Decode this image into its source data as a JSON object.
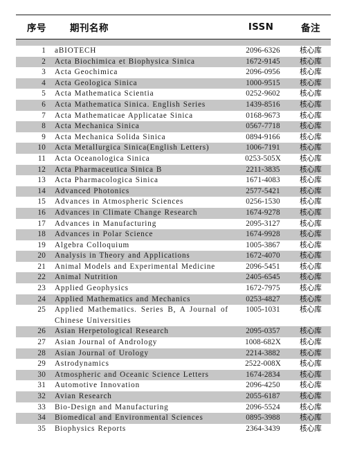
{
  "document": {
    "table": {
      "columns": [
        {
          "key": "index",
          "label": "序号"
        },
        {
          "key": "name",
          "label": "期刊名称"
        },
        {
          "key": "issn",
          "label": "ISSN"
        },
        {
          "key": "note",
          "label": "备注"
        }
      ],
      "rows": [
        {
          "index": "1",
          "name": "aBIOTECH",
          "issn": "2096-6326",
          "note": "核心库"
        },
        {
          "index": "2",
          "name": "Acta Biochimica et Biophysica Sinica",
          "issn": "1672-9145",
          "note": "核心库"
        },
        {
          "index": "3",
          "name": "Acta Geochimica",
          "issn": "2096-0956",
          "note": "核心库"
        },
        {
          "index": "4",
          "name": "Acta Geologica Sinica",
          "issn": "1000-9515",
          "note": "核心库"
        },
        {
          "index": "5",
          "name": "Acta Mathematica Scientia",
          "issn": "0252-9602",
          "note": "核心库"
        },
        {
          "index": "6",
          "name": "Acta Mathematica Sinica. English Series",
          "issn": "1439-8516",
          "note": "核心库"
        },
        {
          "index": "7",
          "name": "Acta Mathematicae Applicatae Sinica",
          "issn": "0168-9673",
          "note": "核心库"
        },
        {
          "index": "8",
          "name": "Acta Mechanica Sinica",
          "issn": "0567-7718",
          "note": "核心库"
        },
        {
          "index": "9",
          "name": "Acta Mechanica Solida Sinica",
          "issn": "0894-9166",
          "note": "核心库"
        },
        {
          "index": "10",
          "name": "Acta Metallurgica Sinica(English Letters)",
          "issn": "1006-7191",
          "note": "核心库"
        },
        {
          "index": "11",
          "name": "Acta Oceanologica Sinica",
          "issn": "0253-505X",
          "note": "核心库"
        },
        {
          "index": "12",
          "name": "Acta Pharmaceutica Sinica B",
          "issn": "2211-3835",
          "note": "核心库"
        },
        {
          "index": "13",
          "name": "Acta Pharmacologica Sinica",
          "issn": "1671-4083",
          "note": "核心库"
        },
        {
          "index": "14",
          "name": "Advanced Photonics",
          "issn": "2577-5421",
          "note": "核心库"
        },
        {
          "index": "15",
          "name": "Advances in Atmospheric Sciences",
          "issn": "0256-1530",
          "note": "核心库"
        },
        {
          "index": "16",
          "name": "Advances in Climate Change Research",
          "issn": "1674-9278",
          "note": "核心库"
        },
        {
          "index": "17",
          "name": "Advances in Manufacturing",
          "issn": "2095-3127",
          "note": "核心库"
        },
        {
          "index": "18",
          "name": "Advances in Polar Science",
          "issn": "1674-9928",
          "note": "核心库"
        },
        {
          "index": "19",
          "name": "Algebra Colloquium",
          "issn": "1005-3867",
          "note": "核心库"
        },
        {
          "index": "20",
          "name": "Analysis in Theory and Applications",
          "issn": "1672-4070",
          "note": "核心库"
        },
        {
          "index": "21",
          "name": "Animal Models and Experimental Medicine",
          "issn": "2096-5451",
          "note": "核心库"
        },
        {
          "index": "22",
          "name": "Animal Nutrition",
          "issn": "2405-6545",
          "note": "核心库"
        },
        {
          "index": "23",
          "name": "Applied Geophysics",
          "issn": "1672-7975",
          "note": "核心库"
        },
        {
          "index": "24",
          "name": "Applied Mathematics and Mechanics",
          "issn": "0253-4827",
          "note": "核心库"
        },
        {
          "index": "25",
          "name": "Applied Mathematics. Series B, A Journal of Chinese Universities",
          "name_lines": [
            "Applied Mathematics. Series B, A Journal of",
            "Chinese Universities"
          ],
          "issn": "1005-1031",
          "note": "核心库"
        },
        {
          "index": "26",
          "name": "Asian Herpetological Research",
          "issn": "2095-0357",
          "note": "核心库"
        },
        {
          "index": "27",
          "name": "Asian Journal of Andrology",
          "issn": "1008-682X",
          "note": "核心库"
        },
        {
          "index": "28",
          "name": "Asian Journal of Urology",
          "issn": "2214-3882",
          "note": "核心库"
        },
        {
          "index": "29",
          "name": "Astrodynamics",
          "issn": "2522-008X",
          "note": "核心库"
        },
        {
          "index": "30",
          "name": "Atmospheric and Oceanic Science Letters",
          "issn": "1674-2834",
          "note": "核心库"
        },
        {
          "index": "31",
          "name": "Automotive Innovation",
          "issn": "2096-4250",
          "note": "核心库"
        },
        {
          "index": "32",
          "name": "Avian Research",
          "issn": "2055-6187",
          "note": "核心库"
        },
        {
          "index": "33",
          "name": "Bio-Design and Manufacturing",
          "issn": "2096-5524",
          "note": "核心库"
        },
        {
          "index": "34",
          "name": "Biomedical and Environmental Sciences",
          "issn": "0895-3988",
          "note": "核心库"
        },
        {
          "index": "35",
          "name": "Biophysics Reports",
          "issn": "2364-3439",
          "note": "核心库"
        }
      ],
      "shading": {
        "even_rows_shaded": true,
        "shade_color": "#c6c6c6"
      }
    }
  }
}
